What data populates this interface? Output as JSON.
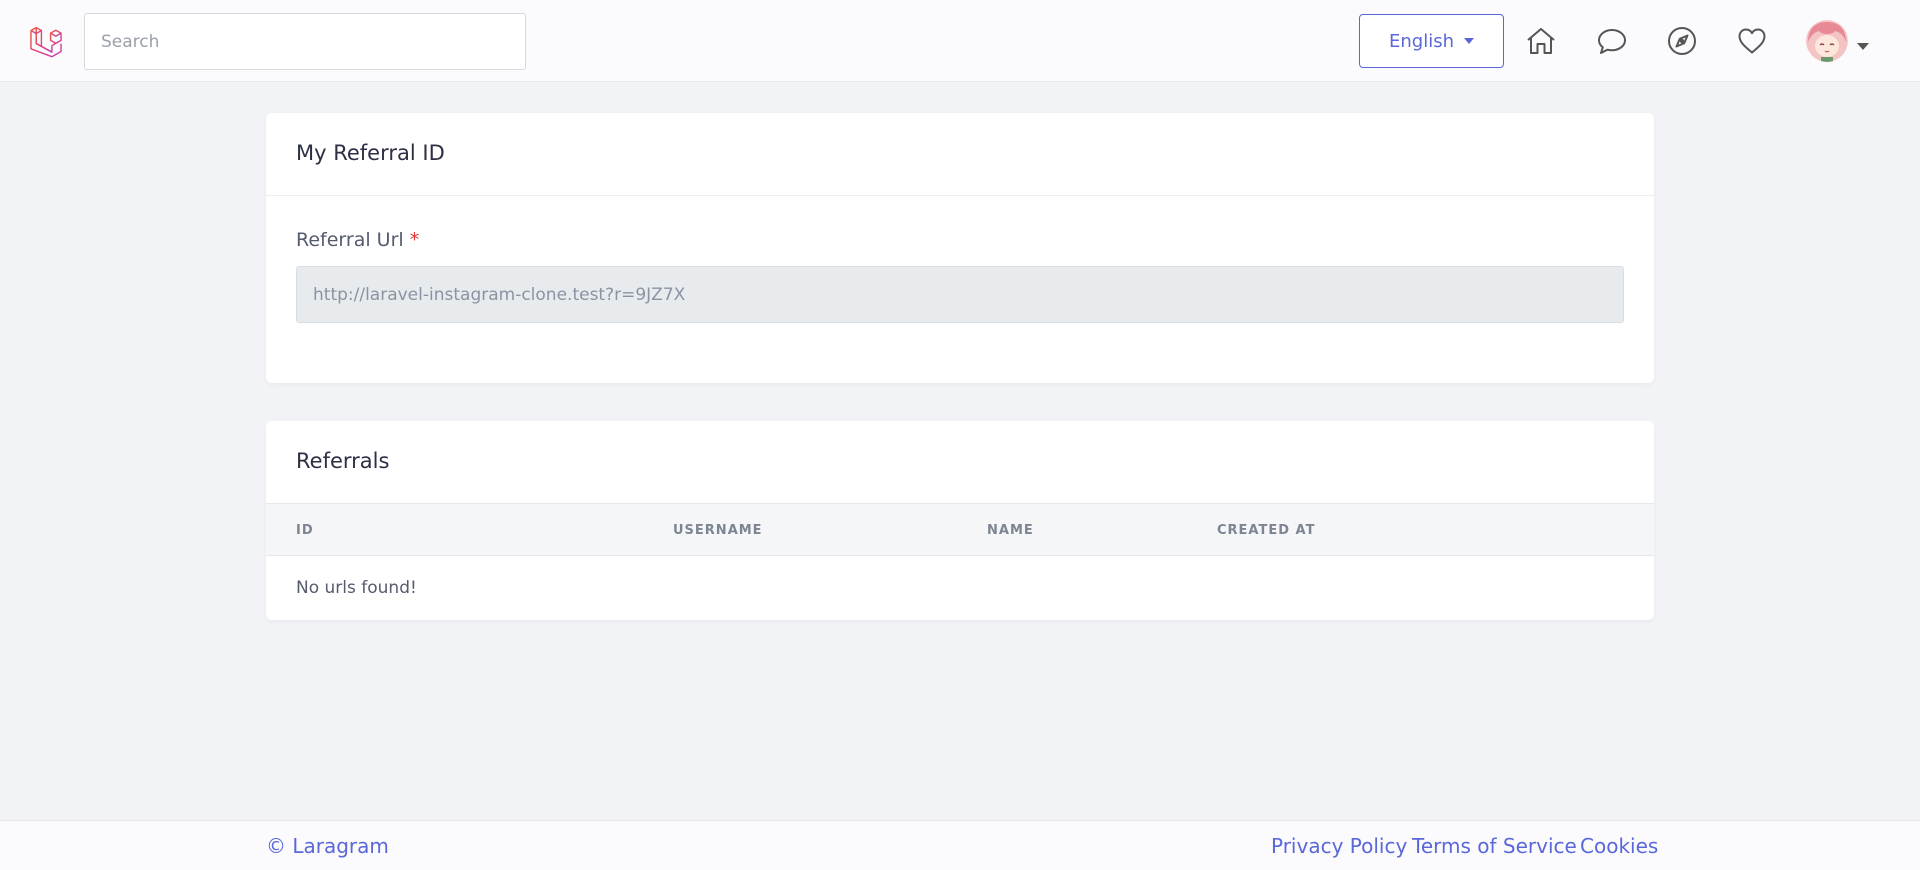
{
  "header": {
    "search_placeholder": "Search",
    "language_label": "English",
    "icons": [
      "home-icon",
      "chat-icon",
      "compass-icon",
      "heart-icon"
    ]
  },
  "referral_card": {
    "title": "My Referral ID",
    "field_label": "Referral Url",
    "required_mark": "*",
    "url_value": "http://laravel-instagram-clone.test?r=9JZ7X"
  },
  "referrals_card": {
    "title": "Referrals",
    "columns": [
      "ID",
      "USERNAME",
      "NAME",
      "CREATED AT"
    ],
    "empty_message": "No urls found!"
  },
  "footer": {
    "brand": "© Laragram",
    "links": [
      "Privacy Policy",
      "Terms of Service",
      "Cookies"
    ]
  },
  "colors": {
    "accent": "#5a67d8",
    "required": "#e3342f",
    "logo": "#ef3b2d"
  }
}
